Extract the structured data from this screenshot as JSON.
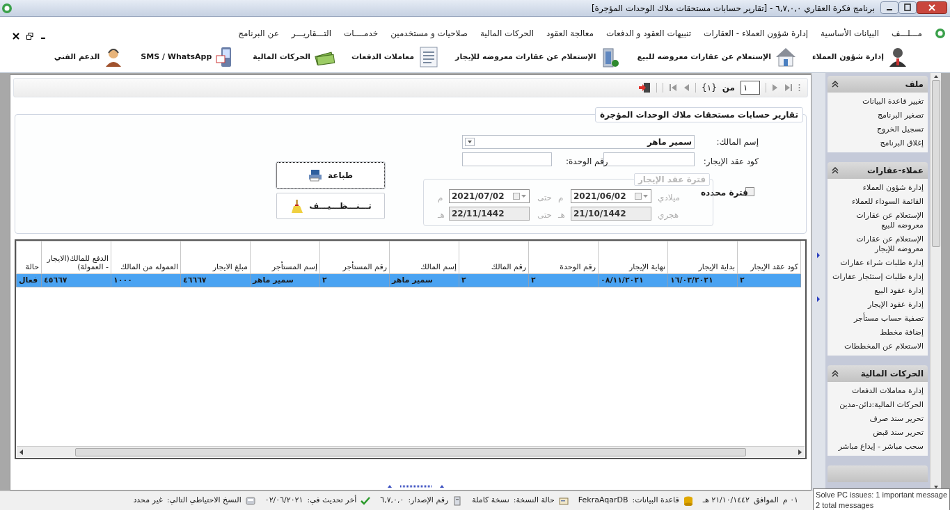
{
  "window": {
    "title": "برنامج فكرة العقاري ٦,٧,٠,٠ - [تقارير حسابات مستحقات ملاك الوحدات المؤجرة]"
  },
  "menu": [
    "مـــلـــف",
    "البيانات الأساسية",
    "إدارة شؤون العملاء - العقارات",
    "تنبيهات العقود و الدفعات",
    "معالجة العقود",
    "الحركات المالية",
    "صلاحيات و مستخدمين",
    "خدمــــات",
    "التـــقاريـــر",
    "عن البرنامج"
  ],
  "toolbar": [
    {
      "label": "إدارة شؤون العملاء",
      "kind": "user"
    },
    {
      "label": "الإستعلام عن عقارات معروضه للبيع",
      "kind": "house"
    },
    {
      "label": "الإستعلام عن عقارات معروضه للإيجار",
      "kind": "building"
    },
    {
      "label": "معاملات الدفعات",
      "kind": "document"
    },
    {
      "label": "الحركات المالية",
      "kind": "money"
    },
    {
      "label": "SMS / WhatsApp",
      "kind": "phone"
    },
    {
      "label": "الدعم الفني",
      "kind": "support"
    }
  ],
  "navigator": {
    "page": "١",
    "of_label": "من",
    "total": "{١}"
  },
  "report": {
    "title": "تقارير حسابات مستحقات ملاك الوحدات المؤجرة",
    "owner": {
      "label": "إسم المالك:",
      "value": "سمير ماهر"
    },
    "contract_code": {
      "label": "كود عقد الإيجار:"
    },
    "unit_no": {
      "label": "رقم الوحدة:"
    },
    "period_check": {
      "label": "فترة محدده",
      "checked": false
    },
    "period": {
      "title": "فترة عقد الإيجار",
      "disabled": true,
      "rows": [
        {
          "kind": "picker",
          "label": "ميلادي",
          "from": "2021/06/02",
          "from_unit": "م",
          "to_label": "حتى",
          "to": "2021/07/02",
          "to_unit": "م"
        },
        {
          "kind": "readonly",
          "label": "هجري",
          "from": "21/10/1442",
          "from_unit": "هـ",
          "to_label": "حتى",
          "to": "22/11/1442",
          "to_unit": "هـ"
        }
      ]
    },
    "buttons": [
      {
        "label": "طباعة",
        "kind": "print",
        "focused": true
      },
      {
        "label": "تـــنـــظـــيـــف",
        "kind": "clear",
        "focused": false
      }
    ]
  },
  "table": {
    "columns": [
      "كود عقد الإيجار",
      "بداية الإيجار",
      "نهاية الإيجار",
      "رقم الوحدة",
      "رقم المالك",
      "إسم المالك",
      "رقم المستأجر",
      "إسم المستأجر",
      "مبلغ الايجار",
      "العموله من المالك",
      "الدفع للمالك(الايجار - العمولة)",
      "حالة"
    ],
    "rows": [
      {
        "selected": true,
        "cells": [
          "٢",
          "١٦/٠٣/٢٠٢١",
          "٠٨/١١/٢٠٢١",
          "٢",
          "٢",
          "سمير ماهر",
          "٢",
          "سمير ماهر",
          "٤٦٦٦٧",
          "١٠٠٠",
          "٤٥٦٦٧",
          "فعال"
        ]
      }
    ]
  },
  "sidebar": {
    "groups": [
      {
        "title": "ملف",
        "expanded": true,
        "items": [
          "تغيير قاعدة البيانات",
          "تصغير البرنامج",
          "تسجيل الخروج",
          "إغلاق البرنامج"
        ]
      },
      {
        "title": "عملاء-عقارات",
        "expanded": true,
        "items": [
          "إدارة شؤون العملاء",
          "القائمة السوداء للعملاء",
          "الإستعلام عن عقارات معروضه للبيع",
          "الإستعلام عن عقارات معروضه للإيجار",
          "إدارة طلبات شراء عقارات",
          "إدارة طلبات إستئجار عقارات",
          "إدارة عقود البيع",
          "إدارة عقود الإيجار",
          "تصفية حساب مستأجر",
          "إضافة مخطط",
          "الاستعلام عن المخططات"
        ]
      },
      {
        "title": "الحركات المالية",
        "expanded": true,
        "items": [
          "إدارة معاملات الدفعات",
          "الحركات المالية:دائن-مدين",
          "تحرير سند صرف",
          "تحرير سند قبض",
          "سحب مباشر - إيداع مباشر"
        ]
      }
    ]
  },
  "status_bar": [
    {
      "kind": "text",
      "text": "٠١ م"
    },
    {
      "kind": "text",
      "text": "الموافق"
    },
    {
      "kind": "text",
      "text": "٢١/١٠/١٤٤٢ هـ"
    },
    {
      "kind": "database",
      "text": "قاعدة البيانات:"
    },
    {
      "kind": "text",
      "text": "FekraAqarDB"
    },
    {
      "kind": "license",
      "text": "حالة النسخة:"
    },
    {
      "kind": "text",
      "text": "نسخة كاملة"
    },
    {
      "kind": "version",
      "text": "رقم الإصدار:"
    },
    {
      "kind": "text",
      "text": "٦,٧,٠,٠"
    },
    {
      "kind": "update",
      "text": "أخر تحديث في:"
    },
    {
      "kind": "text",
      "text": "٠٢/٠٦/٢٠٢١"
    },
    {
      "kind": "backup",
      "text": "النسخ الاحتياطي التالي:"
    },
    {
      "kind": "text",
      "text": "غير محدد"
    }
  ],
  "tooltip": {
    "lines": [
      "Solve PC issues: 1 important message",
      "2 total messages"
    ]
  }
}
